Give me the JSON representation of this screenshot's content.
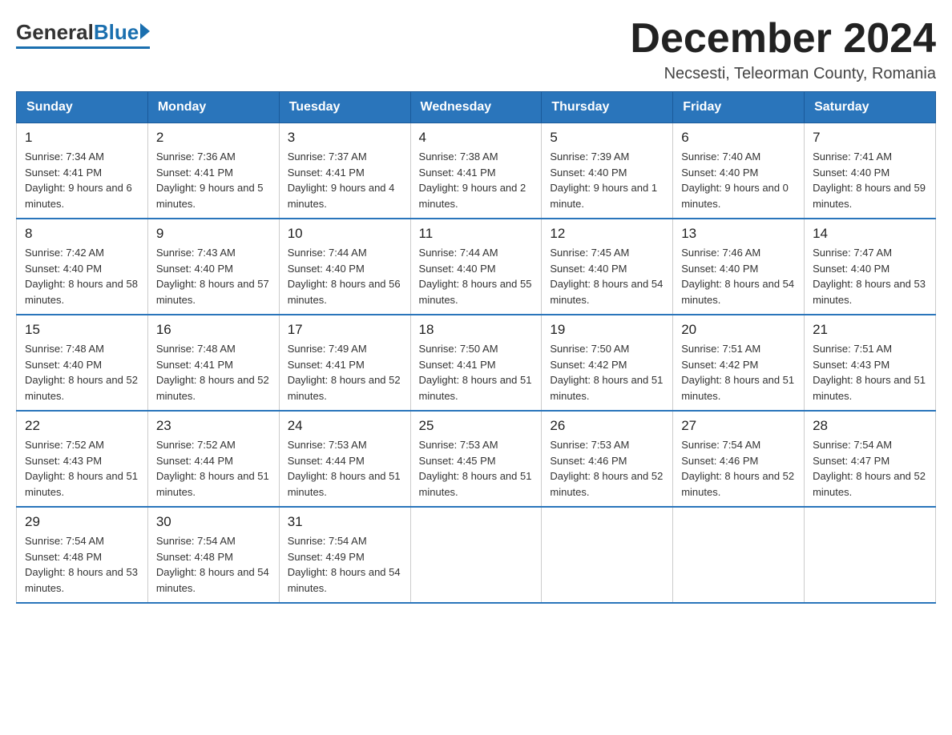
{
  "logo": {
    "general": "General",
    "blue": "Blue"
  },
  "title": "December 2024",
  "location": "Necsesti, Teleorman County, Romania",
  "days_of_week": [
    "Sunday",
    "Monday",
    "Tuesday",
    "Wednesday",
    "Thursday",
    "Friday",
    "Saturday"
  ],
  "weeks": [
    [
      {
        "day": "1",
        "sunrise": "Sunrise: 7:34 AM",
        "sunset": "Sunset: 4:41 PM",
        "daylight": "Daylight: 9 hours and 6 minutes."
      },
      {
        "day": "2",
        "sunrise": "Sunrise: 7:36 AM",
        "sunset": "Sunset: 4:41 PM",
        "daylight": "Daylight: 9 hours and 5 minutes."
      },
      {
        "day": "3",
        "sunrise": "Sunrise: 7:37 AM",
        "sunset": "Sunset: 4:41 PM",
        "daylight": "Daylight: 9 hours and 4 minutes."
      },
      {
        "day": "4",
        "sunrise": "Sunrise: 7:38 AM",
        "sunset": "Sunset: 4:41 PM",
        "daylight": "Daylight: 9 hours and 2 minutes."
      },
      {
        "day": "5",
        "sunrise": "Sunrise: 7:39 AM",
        "sunset": "Sunset: 4:40 PM",
        "daylight": "Daylight: 9 hours and 1 minute."
      },
      {
        "day": "6",
        "sunrise": "Sunrise: 7:40 AM",
        "sunset": "Sunset: 4:40 PM",
        "daylight": "Daylight: 9 hours and 0 minutes."
      },
      {
        "day": "7",
        "sunrise": "Sunrise: 7:41 AM",
        "sunset": "Sunset: 4:40 PM",
        "daylight": "Daylight: 8 hours and 59 minutes."
      }
    ],
    [
      {
        "day": "8",
        "sunrise": "Sunrise: 7:42 AM",
        "sunset": "Sunset: 4:40 PM",
        "daylight": "Daylight: 8 hours and 58 minutes."
      },
      {
        "day": "9",
        "sunrise": "Sunrise: 7:43 AM",
        "sunset": "Sunset: 4:40 PM",
        "daylight": "Daylight: 8 hours and 57 minutes."
      },
      {
        "day": "10",
        "sunrise": "Sunrise: 7:44 AM",
        "sunset": "Sunset: 4:40 PM",
        "daylight": "Daylight: 8 hours and 56 minutes."
      },
      {
        "day": "11",
        "sunrise": "Sunrise: 7:44 AM",
        "sunset": "Sunset: 4:40 PM",
        "daylight": "Daylight: 8 hours and 55 minutes."
      },
      {
        "day": "12",
        "sunrise": "Sunrise: 7:45 AM",
        "sunset": "Sunset: 4:40 PM",
        "daylight": "Daylight: 8 hours and 54 minutes."
      },
      {
        "day": "13",
        "sunrise": "Sunrise: 7:46 AM",
        "sunset": "Sunset: 4:40 PM",
        "daylight": "Daylight: 8 hours and 54 minutes."
      },
      {
        "day": "14",
        "sunrise": "Sunrise: 7:47 AM",
        "sunset": "Sunset: 4:40 PM",
        "daylight": "Daylight: 8 hours and 53 minutes."
      }
    ],
    [
      {
        "day": "15",
        "sunrise": "Sunrise: 7:48 AM",
        "sunset": "Sunset: 4:40 PM",
        "daylight": "Daylight: 8 hours and 52 minutes."
      },
      {
        "day": "16",
        "sunrise": "Sunrise: 7:48 AM",
        "sunset": "Sunset: 4:41 PM",
        "daylight": "Daylight: 8 hours and 52 minutes."
      },
      {
        "day": "17",
        "sunrise": "Sunrise: 7:49 AM",
        "sunset": "Sunset: 4:41 PM",
        "daylight": "Daylight: 8 hours and 52 minutes."
      },
      {
        "day": "18",
        "sunrise": "Sunrise: 7:50 AM",
        "sunset": "Sunset: 4:41 PM",
        "daylight": "Daylight: 8 hours and 51 minutes."
      },
      {
        "day": "19",
        "sunrise": "Sunrise: 7:50 AM",
        "sunset": "Sunset: 4:42 PM",
        "daylight": "Daylight: 8 hours and 51 minutes."
      },
      {
        "day": "20",
        "sunrise": "Sunrise: 7:51 AM",
        "sunset": "Sunset: 4:42 PM",
        "daylight": "Daylight: 8 hours and 51 minutes."
      },
      {
        "day": "21",
        "sunrise": "Sunrise: 7:51 AM",
        "sunset": "Sunset: 4:43 PM",
        "daylight": "Daylight: 8 hours and 51 minutes."
      }
    ],
    [
      {
        "day": "22",
        "sunrise": "Sunrise: 7:52 AM",
        "sunset": "Sunset: 4:43 PM",
        "daylight": "Daylight: 8 hours and 51 minutes."
      },
      {
        "day": "23",
        "sunrise": "Sunrise: 7:52 AM",
        "sunset": "Sunset: 4:44 PM",
        "daylight": "Daylight: 8 hours and 51 minutes."
      },
      {
        "day": "24",
        "sunrise": "Sunrise: 7:53 AM",
        "sunset": "Sunset: 4:44 PM",
        "daylight": "Daylight: 8 hours and 51 minutes."
      },
      {
        "day": "25",
        "sunrise": "Sunrise: 7:53 AM",
        "sunset": "Sunset: 4:45 PM",
        "daylight": "Daylight: 8 hours and 51 minutes."
      },
      {
        "day": "26",
        "sunrise": "Sunrise: 7:53 AM",
        "sunset": "Sunset: 4:46 PM",
        "daylight": "Daylight: 8 hours and 52 minutes."
      },
      {
        "day": "27",
        "sunrise": "Sunrise: 7:54 AM",
        "sunset": "Sunset: 4:46 PM",
        "daylight": "Daylight: 8 hours and 52 minutes."
      },
      {
        "day": "28",
        "sunrise": "Sunrise: 7:54 AM",
        "sunset": "Sunset: 4:47 PM",
        "daylight": "Daylight: 8 hours and 52 minutes."
      }
    ],
    [
      {
        "day": "29",
        "sunrise": "Sunrise: 7:54 AM",
        "sunset": "Sunset: 4:48 PM",
        "daylight": "Daylight: 8 hours and 53 minutes."
      },
      {
        "day": "30",
        "sunrise": "Sunrise: 7:54 AM",
        "sunset": "Sunset: 4:48 PM",
        "daylight": "Daylight: 8 hours and 54 minutes."
      },
      {
        "day": "31",
        "sunrise": "Sunrise: 7:54 AM",
        "sunset": "Sunset: 4:49 PM",
        "daylight": "Daylight: 8 hours and 54 minutes."
      },
      null,
      null,
      null,
      null
    ]
  ]
}
